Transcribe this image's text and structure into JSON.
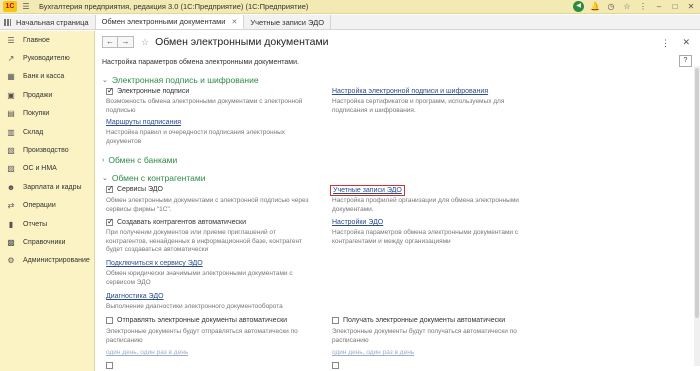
{
  "titlebar": {
    "logo": "1С",
    "app_title": "Бухгалтерия предприятия, редакция 3.0 (1С:Предприятие)   (1С:Предприятие)"
  },
  "tabs": [
    {
      "label": "Начальная страница"
    },
    {
      "label": "Обмен электронными документами"
    },
    {
      "label": "Учетные записи ЭДО"
    }
  ],
  "sidebar": {
    "items": [
      {
        "label": "Главное",
        "icon": "menu-icon"
      },
      {
        "label": "Руководителю",
        "icon": "chart-icon"
      },
      {
        "label": "Банк и касса",
        "icon": "bank-icon"
      },
      {
        "label": "Продажи",
        "icon": "cart-icon"
      },
      {
        "label": "Покупки",
        "icon": "basket-icon"
      },
      {
        "label": "Склад",
        "icon": "warehouse-icon"
      },
      {
        "label": "Производство",
        "icon": "factory-icon"
      },
      {
        "label": "ОС и НМА",
        "icon": "assets-icon"
      },
      {
        "label": "Зарплата и кадры",
        "icon": "people-icon"
      },
      {
        "label": "Операции",
        "icon": "operations-icon"
      },
      {
        "label": "Отчеты",
        "icon": "reports-icon"
      },
      {
        "label": "Справочники",
        "icon": "books-icon"
      },
      {
        "label": "Администрирование",
        "icon": "gear-icon"
      }
    ]
  },
  "main": {
    "title": "Обмен электронными документами",
    "description": "Настройка параметров обмена электронными документами.",
    "help": "?",
    "sections": {
      "sig": "Электронная подпись и шифрование",
      "banks": "Обмен с банками",
      "counterparties": "Обмен с контрагентами"
    },
    "sig": {
      "checkbox_label": "Электронные подписи",
      "checkbox_note": "Возможность обмена электронными документами с электронной подписью",
      "settings_link": "Настройка электронной подписи и шифрования",
      "settings_note": "Настройка сертификатов и программ, используемых для подписания и шифрования.",
      "routes_link": "Маршруты подписания",
      "routes_note": "Настройка правил и очередности подписания электронных документов"
    },
    "edo": {
      "services_label": "Сервисы ЭДО",
      "services_note": "Обмен электронными документами с электронной подписью через сервисы фирмы \"1С\".",
      "accounts_link": "Учетные записи ЭДО",
      "accounts_note": "Настройка профилей организации для обмена электронными документами.",
      "auto_create_label": "Создавать контрагентов автоматически",
      "auto_create_note": "При получении документов или приеме приглашений от контрагентов, ненайденных в информационной базе, контрагент будет создаваться автоматически",
      "edo_settings_link": "Настройки ЭДО",
      "edo_settings_note": "Настройка параметров обмена электронными документами с контрагентами и между организациями",
      "connect_link": "Подключиться к сервису ЭДО",
      "connect_note": "Обмен юридически значимыми электронными документами с сервисом ЭДО",
      "diag_link": "Диагностика ЭДО",
      "diag_note": "Выполнение диагностики электронного документооборота",
      "send_label": "Отправлять электронные документы автоматически",
      "send_note": "Электронные документы будут отправляться автоматически по расписанию",
      "receive_label": "Получать электронные документы автоматически",
      "receive_note": "Электронные документы будут получаться автоматически по расписанию",
      "schedule_left": "один день, один раз в день",
      "schedule_right": "один день, один раз в день"
    }
  }
}
